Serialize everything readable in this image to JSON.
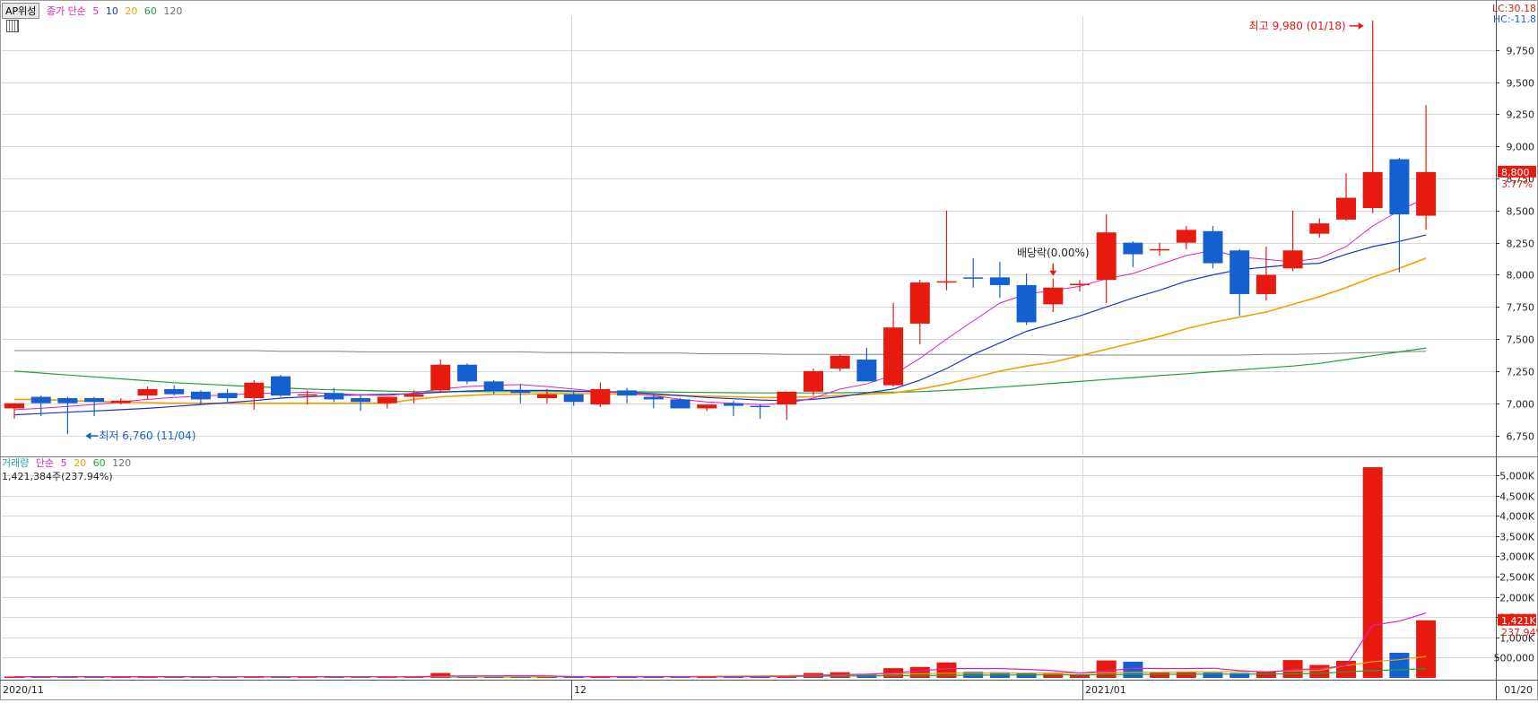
{
  "price_legend": {
    "tag": "AP위성",
    "label": "종가 단순",
    "periods": [
      {
        "text": "5",
        "color": "#e020c0"
      },
      {
        "text": "10",
        "color": "#1a35c8"
      },
      {
        "text": "20",
        "color": "#f0a000"
      },
      {
        "text": "60",
        "color": "#20a040"
      },
      {
        "text": "120",
        "color": "#707070"
      }
    ]
  },
  "volume_legend": {
    "label": "거래량",
    "label2": "단순",
    "periods": [
      {
        "text": "5",
        "color": "#e020c0"
      },
      {
        "text": "20",
        "color": "#f0a000"
      },
      {
        "text": "60",
        "color": "#20a040"
      },
      {
        "text": "120",
        "color": "#707070"
      }
    ],
    "summary": "1,421,384주(237.94%)"
  },
  "right_top": {
    "lc": "LC:30.18",
    "hc": "HC:-11.8"
  },
  "last_price": {
    "value": "8,800",
    "change": "3.77%"
  },
  "last_volume": {
    "value": "1,421K",
    "change": "237.94%"
  },
  "annotations": {
    "high": "최고 9,980 (01/18)",
    "low": "최저 6,760 (11/04)",
    "ex_dividend": "배당락(0.00%)"
  },
  "x_labels": [
    "2020/11",
    "12",
    "2021/01",
    "01/20"
  ],
  "colors": {
    "up": "#e8190f",
    "down": "#1560d0",
    "grid": "#d8d8d8",
    "axis": "#000000"
  },
  "chart_data": [
    {
      "type": "candlestick",
      "ylim": [
        6600,
        10000
      ],
      "yticks": [
        6750,
        7000,
        7250,
        7500,
        7750,
        8000,
        8250,
        8500,
        8750,
        9000,
        9250,
        9500,
        9750
      ],
      "ytick_labels": [
        "6,750",
        "7,000",
        "7,250",
        "7,500",
        "7,750",
        "8,000",
        "8,250",
        "8,500",
        "8,750",
        "9,000",
        "9,250",
        "9,500",
        "9,750"
      ],
      "candles": [
        {
          "o": 6960,
          "h": 7000,
          "l": 6880,
          "c": 7000
        },
        {
          "o": 7050,
          "h": 7060,
          "l": 6900,
          "c": 7000
        },
        {
          "o": 7040,
          "h": 7050,
          "l": 6760,
          "c": 7000
        },
        {
          "o": 7040,
          "h": 7050,
          "l": 6900,
          "c": 7010
        },
        {
          "o": 7000,
          "h": 7040,
          "l": 6990,
          "c": 7020
        },
        {
          "o": 7060,
          "h": 7130,
          "l": 7030,
          "c": 7110
        },
        {
          "o": 7110,
          "h": 7140,
          "l": 7060,
          "c": 7070
        },
        {
          "o": 7090,
          "h": 7100,
          "l": 6990,
          "c": 7030
        },
        {
          "o": 7080,
          "h": 7110,
          "l": 7010,
          "c": 7040
        },
        {
          "o": 7040,
          "h": 7180,
          "l": 6950,
          "c": 7160
        },
        {
          "o": 7210,
          "h": 7220,
          "l": 7050,
          "c": 7060
        },
        {
          "o": 7060,
          "h": 7100,
          "l": 6990,
          "c": 7070
        },
        {
          "o": 7080,
          "h": 7120,
          "l": 7010,
          "c": 7030
        },
        {
          "o": 7040,
          "h": 7070,
          "l": 6940,
          "c": 7010
        },
        {
          "o": 7000,
          "h": 7050,
          "l": 6960,
          "c": 7050
        },
        {
          "o": 7050,
          "h": 7100,
          "l": 7000,
          "c": 7070
        },
        {
          "o": 7100,
          "h": 7340,
          "l": 7080,
          "c": 7300
        },
        {
          "o": 7300,
          "h": 7310,
          "l": 7150,
          "c": 7170
        },
        {
          "o": 7170,
          "h": 7180,
          "l": 7070,
          "c": 7100
        },
        {
          "o": 7100,
          "h": 7150,
          "l": 7000,
          "c": 7080
        },
        {
          "o": 7040,
          "h": 7110,
          "l": 7000,
          "c": 7070
        },
        {
          "o": 7070,
          "h": 7100,
          "l": 6980,
          "c": 7010
        },
        {
          "o": 6990,
          "h": 7160,
          "l": 6970,
          "c": 7110
        },
        {
          "o": 7100,
          "h": 7120,
          "l": 7000,
          "c": 7060
        },
        {
          "o": 7050,
          "h": 7070,
          "l": 6960,
          "c": 7030
        },
        {
          "o": 7030,
          "h": 7040,
          "l": 6960,
          "c": 6960
        },
        {
          "o": 6960,
          "h": 6990,
          "l": 6940,
          "c": 6990
        },
        {
          "o": 7000,
          "h": 7020,
          "l": 6900,
          "c": 6980
        },
        {
          "o": 6980,
          "h": 6990,
          "l": 6880,
          "c": 6970
        },
        {
          "o": 6990,
          "h": 7060,
          "l": 6870,
          "c": 7090
        },
        {
          "o": 7090,
          "h": 7270,
          "l": 7060,
          "c": 7250
        },
        {
          "o": 7270,
          "h": 7380,
          "l": 7250,
          "c": 7370
        },
        {
          "o": 7340,
          "h": 7430,
          "l": 7170,
          "c": 7170
        },
        {
          "o": 7140,
          "h": 7780,
          "l": 7130,
          "c": 7590
        },
        {
          "o": 7620,
          "h": 7960,
          "l": 7460,
          "c": 7940
        },
        {
          "o": 7940,
          "h": 8500,
          "l": 7880,
          "c": 7950
        },
        {
          "o": 7980,
          "h": 8130,
          "l": 7900,
          "c": 7970
        },
        {
          "o": 7980,
          "h": 8100,
          "l": 7820,
          "c": 7920
        },
        {
          "o": 7920,
          "h": 8010,
          "l": 7610,
          "c": 7630
        },
        {
          "o": 7770,
          "h": 7970,
          "l": 7710,
          "c": 7900
        },
        {
          "o": 7920,
          "h": 7960,
          "l": 7870,
          "c": 7930
        },
        {
          "o": 7960,
          "h": 8470,
          "l": 7780,
          "c": 8330
        },
        {
          "o": 8250,
          "h": 8260,
          "l": 8060,
          "c": 8160
        },
        {
          "o": 8200,
          "h": 8250,
          "l": 8150,
          "c": 8200
        },
        {
          "o": 8250,
          "h": 8380,
          "l": 8200,
          "c": 8350
        },
        {
          "o": 8340,
          "h": 8380,
          "l": 8050,
          "c": 8090
        },
        {
          "o": 8190,
          "h": 8200,
          "l": 7680,
          "c": 7850
        },
        {
          "o": 7850,
          "h": 8220,
          "l": 7800,
          "c": 8000
        },
        {
          "o": 8050,
          "h": 8500,
          "l": 8030,
          "c": 8190
        },
        {
          "o": 8320,
          "h": 8440,
          "l": 8290,
          "c": 8400
        },
        {
          "o": 8430,
          "h": 8790,
          "l": 8420,
          "c": 8600
        },
        {
          "o": 8520,
          "h": 9980,
          "l": 8480,
          "c": 8800
        },
        {
          "o": 8900,
          "h": 8910,
          "l": 8020,
          "c": 8470
        },
        {
          "o": 8460,
          "h": 9320,
          "l": 8350,
          "c": 8800
        }
      ],
      "ma": {
        "ma5": [
          6950,
          6960,
          6975,
          6990,
          7010,
          7030,
          7045,
          7055,
          7065,
          7075,
          7080,
          7085,
          7075,
          7065,
          7060,
          7080,
          7110,
          7130,
          7140,
          7145,
          7130,
          7110,
          7090,
          7080,
          7060,
          7030,
          7010,
          7000,
          6990,
          7000,
          7040,
          7110,
          7150,
          7220,
          7350,
          7500,
          7640,
          7780,
          7850,
          7880,
          7910,
          7970,
          8010,
          8080,
          8150,
          8190,
          8140,
          8120,
          8100,
          8130,
          8220,
          8380,
          8500,
          8600
        ],
        "ma10": [
          6910,
          6920,
          6930,
          6940,
          6950,
          6960,
          6975,
          6990,
          7005,
          7020,
          7040,
          7050,
          7060,
          7065,
          7070,
          7075,
          7085,
          7095,
          7100,
          7100,
          7100,
          7095,
          7090,
          7085,
          7075,
          7060,
          7045,
          7035,
          7025,
          7020,
          7030,
          7050,
          7080,
          7110,
          7180,
          7270,
          7380,
          7470,
          7560,
          7620,
          7680,
          7750,
          7820,
          7880,
          7950,
          8000,
          8040,
          8060,
          8080,
          8090,
          8160,
          8220,
          8260,
          8310
        ],
        "ma20": [
          7030,
          7030,
          7020,
          7015,
          7010,
          7005,
          7000,
          7000,
          7000,
          7000,
          7000,
          7000,
          7000,
          7000,
          7000,
          7030,
          7050,
          7060,
          7070,
          7070,
          7075,
          7075,
          7075,
          7070,
          7065,
          7060,
          7055,
          7050,
          7045,
          7045,
          7050,
          7060,
          7070,
          7080,
          7110,
          7150,
          7200,
          7250,
          7290,
          7320,
          7370,
          7420,
          7470,
          7520,
          7580,
          7630,
          7670,
          7710,
          7770,
          7830,
          7900,
          7980,
          8050,
          8130
        ],
        "ma60": [
          7250,
          7235,
          7220,
          7205,
          7190,
          7175,
          7160,
          7150,
          7140,
          7130,
          7120,
          7110,
          7105,
          7100,
          7095,
          7090,
          7090,
          7090,
          7090,
          7090,
          7090,
          7090,
          7090,
          7090,
          7088,
          7086,
          7084,
          7082,
          7080,
          7080,
          7080,
          7082,
          7084,
          7086,
          7090,
          7100,
          7110,
          7125,
          7140,
          7155,
          7170,
          7185,
          7200,
          7215,
          7230,
          7245,
          7260,
          7275,
          7290,
          7310,
          7340,
          7370,
          7400,
          7430
        ],
        "ma120": [
          7410,
          7410,
          7410,
          7410,
          7410,
          7410,
          7410,
          7410,
          7410,
          7410,
          7405,
          7405,
          7405,
          7400,
          7400,
          7400,
          7400,
          7400,
          7400,
          7400,
          7395,
          7395,
          7395,
          7390,
          7390,
          7390,
          7385,
          7385,
          7385,
          7380,
          7380,
          7380,
          7380,
          7380,
          7380,
          7380,
          7380,
          7380,
          7380,
          7375,
          7375,
          7375,
          7375,
          7375,
          7375,
          7375,
          7375,
          7380,
          7380,
          7385,
          7390,
          7395,
          7400,
          7405
        ]
      }
    },
    {
      "type": "bar",
      "series_name": "거래량",
      "ylim": [
        0,
        5400000
      ],
      "yticks": [
        500000,
        1000000,
        1500000,
        2000000,
        2500000,
        3000000,
        3500000,
        4000000,
        4500000,
        5000000
      ],
      "ytick_labels": [
        "500,000",
        "1,000K",
        "1,500K",
        "2,000K",
        "2,500K",
        "3,000K",
        "3,500K",
        "4,000K",
        "4,500K",
        "5,000K"
      ],
      "values": [
        35000,
        30000,
        40000,
        30000,
        25000,
        30000,
        25000,
        22000,
        25000,
        40000,
        35000,
        25000,
        22000,
        25000,
        22000,
        25000,
        120000,
        45000,
        35000,
        30000,
        25000,
        25000,
        30000,
        40000,
        30000,
        20000,
        25000,
        45000,
        40000,
        60000,
        120000,
        140000,
        100000,
        240000,
        270000,
        380000,
        150000,
        140000,
        120000,
        100000,
        80000,
        430000,
        400000,
        130000,
        140000,
        130000,
        120000,
        160000,
        440000,
        320000,
        420000,
        5200000,
        620000,
        1421384
      ],
      "ma5": [
        30000,
        30000,
        31000,
        32000,
        32000,
        31000,
        30000,
        28000,
        27000,
        28000,
        29000,
        29000,
        29000,
        29000,
        28000,
        26000,
        45000,
        50000,
        52000,
        55000,
        52000,
        32000,
        30000,
        30000,
        30000,
        29000,
        28000,
        32000,
        32000,
        38000,
        58000,
        80000,
        92000,
        122000,
        170000,
        230000,
        230000,
        230000,
        210000,
        180000,
        120000,
        170000,
        235000,
        230000,
        230000,
        240000,
        180000,
        140000,
        200000,
        230000,
        300000,
        1300000,
        1400000,
        1600000
      ],
      "ma20": [
        28000,
        28000,
        28000,
        28000,
        28000,
        28000,
        28000,
        28000,
        28000,
        28000,
        28000,
        29000,
        30000,
        31000,
        32000,
        33000,
        34000,
        35000,
        35000,
        35000,
        35000,
        35000,
        35000,
        35000,
        36000,
        37000,
        40000,
        45000,
        50000,
        55000,
        65000,
        75000,
        85000,
        95000,
        105000,
        115000,
        120000,
        120000,
        120000,
        120000,
        120000,
        125000,
        135000,
        140000,
        145000,
        150000,
        155000,
        160000,
        170000,
        185000,
        300000,
        400000,
        450000,
        530000
      ],
      "ma60": [
        25000,
        25000,
        25000,
        25000,
        25000,
        25000,
        25000,
        25000,
        25000,
        25000,
        25000,
        25000,
        25000,
        25000,
        25000,
        25000,
        25000,
        25000,
        26000,
        26000,
        26000,
        27000,
        27000,
        28000,
        29000,
        30000,
        32000,
        34000,
        36000,
        38000,
        42000,
        46000,
        50000,
        54000,
        58000,
        62000,
        66000,
        70000,
        72000,
        74000,
        76000,
        80000,
        84000,
        88000,
        90000,
        92000,
        94000,
        96000,
        100000,
        110000,
        150000,
        180000,
        200000,
        230000
      ]
    }
  ]
}
